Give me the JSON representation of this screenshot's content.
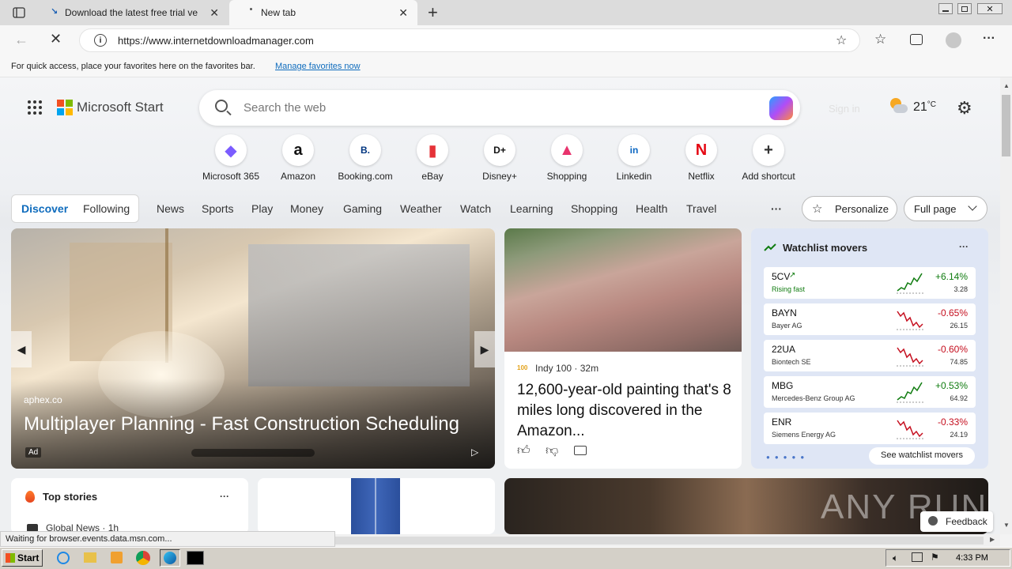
{
  "browser": {
    "tabs": [
      {
        "title": "Download the latest free trial ve",
        "close": "✕"
      },
      {
        "title": "New tab",
        "close": "✕"
      }
    ],
    "new_tab": "+",
    "url": "https://www.internetdownloadmanager.com",
    "favorites_bar": {
      "text": "For quick access, place your favorites here on the favorites bar.",
      "link": "Manage favorites now"
    },
    "status": "Waiting for browser.events.data.msn.com..."
  },
  "header": {
    "brand": "Microsoft Start",
    "search_placeholder": "Search the web",
    "sign_in": "Sign in",
    "temperature": "21",
    "temp_unit": "°C"
  },
  "shortcuts": [
    {
      "label": "Microsoft 365",
      "icon": "microsoft365-icon",
      "glyph": "◆",
      "color": "#7b5cff"
    },
    {
      "label": "Amazon",
      "icon": "amazon-icon",
      "glyph": "a",
      "color": "#111111"
    },
    {
      "label": "Booking.com",
      "icon": "booking-icon",
      "glyph": "B.",
      "color": "#003580"
    },
    {
      "label": "eBay",
      "icon": "ebay-icon",
      "glyph": "▮",
      "color": "#e53238"
    },
    {
      "label": "Disney+",
      "icon": "disney-icon",
      "glyph": "D+",
      "color": "#111111"
    },
    {
      "label": "Shopping",
      "icon": "shopping-bag-icon",
      "glyph": "▲",
      "color": "#e8336d"
    },
    {
      "label": "Linkedin",
      "icon": "linkedin-icon",
      "glyph": "in",
      "color": "#0a66c2"
    },
    {
      "label": "Netflix",
      "icon": "netflix-icon",
      "glyph": "N",
      "color": "#e50914"
    },
    {
      "label": "Add shortcut",
      "icon": "plus-icon",
      "glyph": "+",
      "color": "#333333"
    }
  ],
  "nav": {
    "discover": "Discover",
    "following": "Following",
    "items": [
      "News",
      "Sports",
      "Play",
      "Money",
      "Gaming",
      "Weather",
      "Watch",
      "Learning",
      "Shopping",
      "Health",
      "Travel"
    ],
    "more": "···",
    "personalize": "Personalize",
    "full_page": "Full page"
  },
  "hero": {
    "source": "aphex.co",
    "title": "Multiplayer Planning - Fast Construction Scheduling",
    "ad": "Ad"
  },
  "article": {
    "source": "Indy 100",
    "time": "32m",
    "title": "12,600-year-old painting that's 8 miles long discovered in the Amazon..."
  },
  "watchlist": {
    "title": "Watchlist movers",
    "more": "···",
    "rows": [
      {
        "symbol": "5CV",
        "name": "Rising fast",
        "change": "+6.14%",
        "price": "3.28",
        "up": true
      },
      {
        "symbol": "BAYN",
        "name": "Bayer AG",
        "change": "-0.65%",
        "price": "26.15",
        "up": false
      },
      {
        "symbol": "22UA",
        "name": "Biontech SE",
        "change": "-0.60%",
        "price": "74.85",
        "up": false
      },
      {
        "symbol": "MBG",
        "name": "Mercedes-Benz Group AG",
        "change": "+0.53%",
        "price": "64.92",
        "up": true
      },
      {
        "symbol": "ENR",
        "name": "Siemens Energy AG",
        "change": "-0.33%",
        "price": "24.19",
        "up": false
      }
    ],
    "see_more": "See watchlist movers"
  },
  "top_stories": {
    "title": "Top stories",
    "more": "···",
    "first_source": "Global News · 1h"
  },
  "feedback": "Feedback",
  "watermark": "ANY RUN",
  "taskbar": {
    "start": "Start",
    "time": "4:33 PM"
  },
  "colors": {
    "accent": "#0f6cbd",
    "up": "#107c10",
    "down": "#c50f1f"
  }
}
